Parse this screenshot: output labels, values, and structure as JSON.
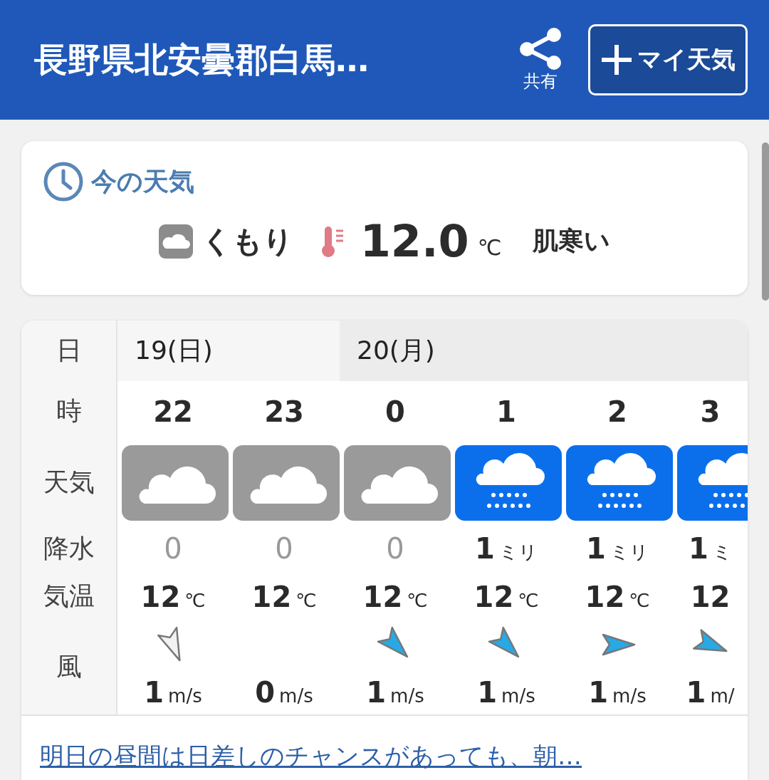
{
  "header": {
    "title": "長野県北安曇郡白馬…",
    "share_label": "共有",
    "my_weather_button": "マイ天気"
  },
  "current": {
    "title": "今の天気",
    "condition": "くもり",
    "temperature": "12.0",
    "temp_unit": "℃",
    "feeling": "肌寒い"
  },
  "forecast": {
    "row_labels": [
      "日",
      "時",
      "天気",
      "降水",
      "気温",
      "風"
    ],
    "days": [
      {
        "label": "19(日)",
        "hours": [
          {
            "hour": "22",
            "kind": "cloudy",
            "precip": "0",
            "temp": "12",
            "temp_unit": "℃",
            "wind_arrow": {
              "kind": "SSE",
              "outlined": true
            },
            "wind": "1",
            "wind_unit": "m/s"
          },
          {
            "hour": "23",
            "kind": "cloudy",
            "precip": "0",
            "temp": "12",
            "temp_unit": "℃",
            "wind": "0",
            "wind_unit": "m/s"
          }
        ]
      },
      {
        "label": "20(月)",
        "hours": [
          {
            "hour": "0",
            "kind": "cloudy",
            "precip": "0",
            "temp": "12",
            "temp_unit": "℃",
            "wind_arrow": {
              "kind": "SE",
              "outlined": false
            },
            "wind": "1",
            "wind_unit": "m/s"
          },
          {
            "hour": "1",
            "kind": "rain",
            "precip": "1",
            "precip_unit": "ミリ",
            "temp": "12",
            "temp_unit": "℃",
            "wind_arrow": {
              "kind": "SE",
              "outlined": false
            },
            "wind": "1",
            "wind_unit": "m/s"
          },
          {
            "hour": "2",
            "kind": "rain",
            "precip": "1",
            "precip_unit": "ミリ",
            "temp": "12",
            "temp_unit": "℃",
            "wind_arrow": {
              "kind": "E",
              "outlined": false
            },
            "wind": "1",
            "wind_unit": "m/s"
          },
          {
            "hour": "3",
            "kind": "rain",
            "precip": "1",
            "precip_unit": "ミ",
            "temp": "12",
            "wind_arrow": {
              "kind": "ESE",
              "outlined": false
            },
            "wind": "1",
            "wind_unit": "m/"
          }
        ]
      }
    ]
  },
  "comment_link": "明日の昼間は日差しのチャンスがあっても、朝…"
}
